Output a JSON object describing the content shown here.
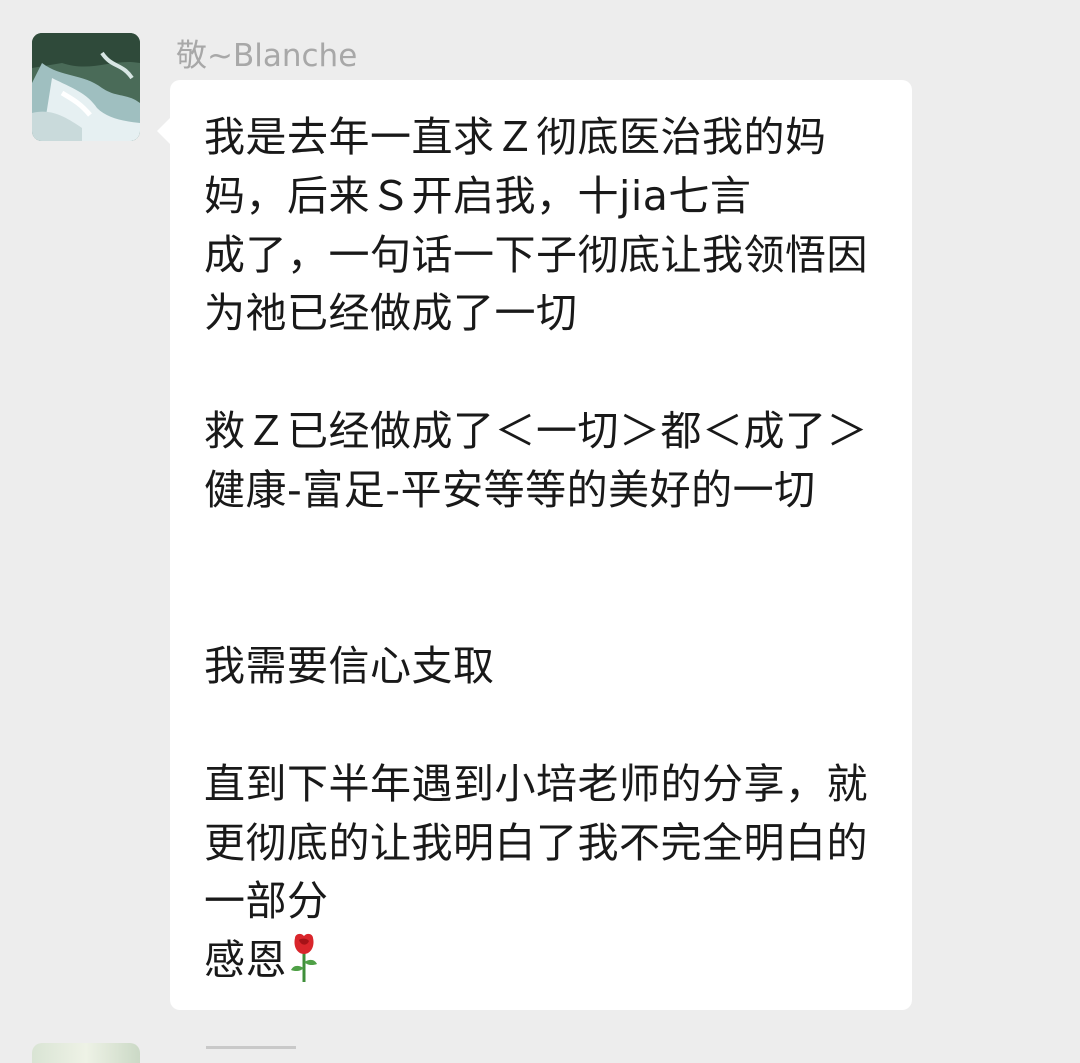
{
  "sender": {
    "name": "敬~Blanche",
    "avatar_icon": "waterfall-photo-avatar"
  },
  "message": {
    "text_line1": "我是去年一直求Ｚ彻底医治我的妈妈，后来Ｓ开启我，十jia七言\n成了，一句话一下子彻底让我领悟因为祂已经做成了一切\n\n救Ｚ已经做成了＜一切＞都＜成了＞健康-富足-平安等等的美好的一切\n\n\n我需要信心支取\n\n直到下半年遇到小培老师的分享，就更彻底的让我明白了我不完全明白的一部分\n感恩",
    "emoji": "rose-icon"
  },
  "colors": {
    "background": "#ededed",
    "bubble": "#ffffff",
    "text": "#191919",
    "sender_name": "#a8a8a8"
  }
}
